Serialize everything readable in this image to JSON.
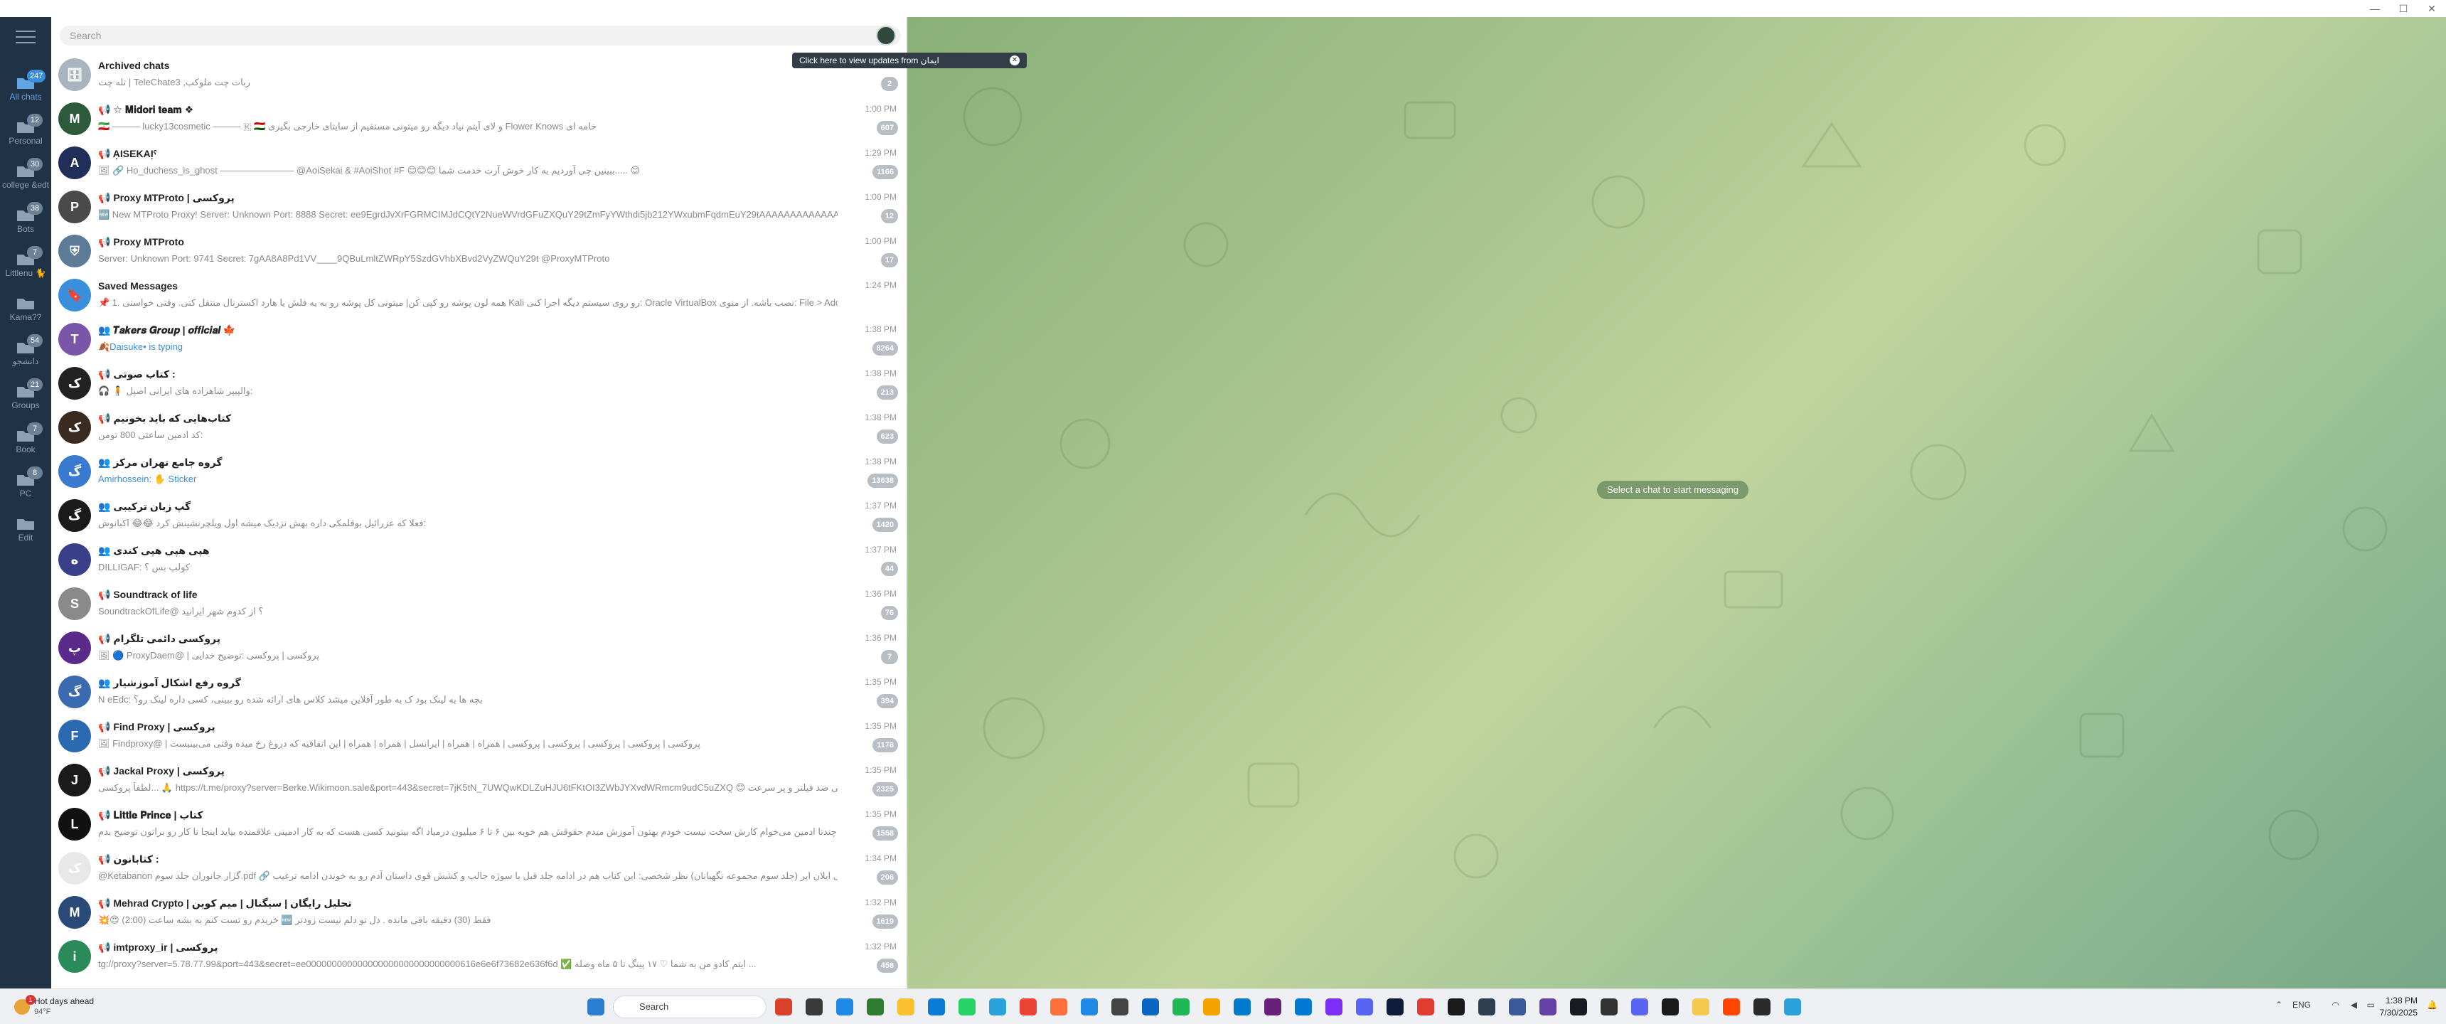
{
  "window": {
    "minimize": "—",
    "maximize": "☐",
    "close": "✕"
  },
  "folders": [
    {
      "label": "All chats",
      "badge": "247",
      "icon": "chat-bubbles-icon",
      "active": true
    },
    {
      "label": "Personal",
      "badge": "12",
      "icon": "folder-icon"
    },
    {
      "label": "college &edt",
      "badge": "30",
      "icon": "folder-icon"
    },
    {
      "label": "Bots",
      "badge": "38",
      "icon": "folder-icon"
    },
    {
      "label": "Littlenu 🐈",
      "badge": "7",
      "icon": "folder-icon"
    },
    {
      "label": "Kama??",
      "badge": "",
      "icon": "folder-icon"
    },
    {
      "label": "دانشجو",
      "badge": "54",
      "icon": "folder-icon"
    },
    {
      "label": "Groups",
      "badge": "21",
      "icon": "folder-icon"
    },
    {
      "label": "Book",
      "badge": "7",
      "icon": "folder-icon"
    },
    {
      "label": "PC",
      "badge": "8",
      "icon": "folder-icon"
    },
    {
      "label": "Edit",
      "badge": "",
      "icon": "edit-icon"
    }
  ],
  "search": {
    "placeholder": "Search"
  },
  "tooltip": {
    "text": "Click here to view updates from ایمان",
    "close": "✕"
  },
  "chats": [
    {
      "name": "Archived chats",
      "preview": "تله چت | TeleChate3 ,ربات چت ملوکب",
      "time": "",
      "badge": "2",
      "avatar_color": "#a9b4be",
      "avatar_text": "🗄"
    },
    {
      "name": "📢 ☆ 𝐌𝐢𝐝𝐨𝐫𝐢 𝐭𝐞𝐚𝐦 ❖",
      "preview": "🇮🇷 ——— lucky13cosmetic ——— 🇰 🇹🇯 و لای آیتم نیاد دیگه رو میتونی مستقیم از سایتای خارجی بگیری Flower Knows خامه ای",
      "time": "1:00 PM",
      "badge": "607",
      "avatar_color": "#2d5a3a",
      "avatar_text": "M"
    },
    {
      "name": "📢 A᷊ISEKAI᷊ˁ",
      "preview": "🖼 🔗 Ho_duchess_is_ghost ———————— @AoiSekai & #AoiShot #F 😊😊😊 ببینین چی آوردیم به کار خوش آرت خدمت شما..... 😊",
      "time": "1:29 PM",
      "badge": "1166",
      "avatar_color": "#1f2f5a",
      "avatar_text": "A"
    },
    {
      "name": "📢 Proxy MTProto | پروکسی",
      "preview": "🆕 New MTProto Proxy! Server: Unknown Port: 8888 Secret: ee9EgrdJvXrFGRMCIMJdCQtY2NueWVrdGFuZXQuY29tZmFyYWthdi5jb212YWxubmFqdmEuY29tAAAAAAAAAAAAAAAAAAAAAAAAAA...",
      "time": "1:00 PM",
      "badge": "12",
      "avatar_color": "#4a4a4a",
      "avatar_text": "P"
    },
    {
      "name": "📢 Proxy MTProto",
      "preview": "Server: Unknown Port: 9741 Secret: 7gAA8A8Pd1VV____9QBuLmltZWRpY5SzdGVhbXBvd2VyZWQuY29t @ProxyMTProto",
      "time": "1:00 PM",
      "badge": "17",
      "avatar_color": "#5d7a96",
      "avatar_text": "⛨"
    },
    {
      "name": "Saved Messages",
      "preview": "📌 1. همه لون پوشه رو کپی کن| میتونی کل پوشه رو به یه فلش یا هارد اکسترنال منتقل کنی. وقتی خواستی Kali رو روی سیستم دیگه اجرا کنی: Oracle VirtualBox نصب باشه. از منوی: File > Add ← Machine > Add ...sq| Copy Edit",
      "time": "1:24 PM",
      "badge": "",
      "avatar_color": "#3a8fdc",
      "avatar_text": "🔖"
    },
    {
      "name": "👥 𝑻𝒂𝒌𝒆𝒓𝒔 𝑮𝒓𝒐𝒖𝒑 | 𝒐𝒇𝒇𝒊𝒄𝒊𝒂𝒍 🍁",
      "preview": "🍂Daisuke• is typing",
      "time": "1:38 PM",
      "badge": "8264",
      "avatar_color": "#7a56a8",
      "avatar_text": "T",
      "preview_hl": true
    },
    {
      "name": "📢 کتاب صوتی :",
      "preview": "🎧 🧍 والپیپر شاهزاده های ایرانی اصیل:",
      "time": "1:38 PM",
      "badge": "213",
      "avatar_color": "#222222",
      "avatar_text": "ک"
    },
    {
      "name": "📢 کتاب‌هایی که باید بخونیم",
      "preview": "کد ادمین ساعتی 800 تومن:",
      "time": "1:38 PM",
      "badge": "623",
      "avatar_color": "#3b2a20",
      "avatar_text": "ک"
    },
    {
      "name": "👥 گروه جامع تهران مرکز",
      "preview": "Amirhossein: ✋ Sticker",
      "time": "1:38 PM",
      "badge": "13638",
      "avatar_color": "#3a7ad0",
      "avatar_text": "گ",
      "preview_hl": true
    },
    {
      "name": "👥 گپ زبان ترکیبی",
      "preview": "فعلا که عزرائیل بوقلمکی داره بهش نزدیک میشه اول ویلچرنشینش کرد 😂😂 اکبانوش:",
      "time": "1:37 PM",
      "badge": "1420",
      "avatar_color": "#1a1a1a",
      "avatar_text": "گ"
    },
    {
      "name": "👥 هپی هپی هپی کندی",
      "preview": "DILLIGAF: کولپ بس ؟",
      "time": "1:37 PM",
      "badge": "44",
      "avatar_color": "#3a3f8a",
      "avatar_text": "ه"
    },
    {
      "name": "📢 Soundtrack of life",
      "preview": "SoundtrackOfLife@ ؟ از کدوم شهر ایرانید",
      "time": "1:36 PM",
      "badge": "76",
      "avatar_color": "#8a8a8a",
      "avatar_text": "S"
    },
    {
      "name": "📢 پروکسی دائمی تلگرام",
      "preview": "🖼 🔵 ProxyDaem@ | پروکسی | پروکسی :توضیح خدایی",
      "time": "1:36 PM",
      "badge": "7",
      "avatar_color": "#5a2a8a",
      "avatar_text": "پ"
    },
    {
      "name": "👥 گروه رفع اشکال آموزشیار",
      "preview": "N eEdc: بچه ها یه لینک بود ک به طور آفلاین میشد کلاس های ارائه شده رو ببینی، کسی داره لینک رو؟",
      "time": "1:35 PM",
      "badge": "394",
      "avatar_color": "#3a6ab0",
      "avatar_text": "گ"
    },
    {
      "name": "📢 Find Proxy | پروکسی",
      "preview": "🖼 Findproxy@ | پروکسی | پروکسی | پروکسی | پروکسی | پروکسی | همراه | همراه | ایرانسل | همراه | همراه | این اتفاقیه که دروغ رخ میده وقتی می‌بینیست",
      "time": "1:35 PM",
      "badge": "1178",
      "avatar_color": "#2a6ab0",
      "avatar_text": "F"
    },
    {
      "name": "📢 Jackal Proxy | پروکسی",
      "preview": "لطفاً پروکسی... 🙏 https://t.me/proxy?server=Berke.Wikimoon.sale&port=443&secret=7jK5tN_7UWQwKDLZuHJU6tFKtOI3ZWbJYXvdWRmcm9udC5uZXQ 😊 پروکسی ضد فیلتر و پر سرعت",
      "time": "1:35 PM",
      "badge": "2325",
      "avatar_color": "#1a1a1a",
      "avatar_text": "J"
    },
    {
      "name": "📢 𝐋𝐢𝐭𝐭𝐥𝐞 𝐏𝐫𝐢𝐧𝐜𝐞 | کتاب",
      "preview": "بچه‌ها چندتا ادمین می‌خوام کارش سخت نیست خودم بهتون آموزش میدم حقوقش هم خوبه بین ۶ تا ۶ میلیون درمیاد اگه بیتونید کسی هست که به کار ادمینی علاقمنده بیاید اینجا تا کار رو براتون توضیح بدم ...",
      "time": "1:35 PM",
      "badge": "1558",
      "avatar_color": "#111111",
      "avatar_text": "L"
    },
    {
      "name": "📢 کتابانون :",
      "preview": "@Ketabanon گزار جانوران جلد سوم.pdf 🔗 گلزار جانوران به نویسندگی ایلان ایر (جلد سوم مجموعه نگهبانان) نظر شخصی: این کتاب هم در ادامه جلد قبل با سوژه جالب و کشش قوی داستان آدم رو به خوندن ادامه ترغیب...",
      "time": "1:34 PM",
      "badge": "206",
      "avatar_color": "#e8e8e8",
      "avatar_text": "ک"
    },
    {
      "name": "📢 Mehrad Crypto | تحلیل رایگان | سیگنال | میم کوین",
      "preview": "💥😍 خریدم رو تست کنم به بشه ساعت (2:00) 🆕 فقط (30) دقیقه باقی مانده . دل تو دلم نیست زودتر",
      "time": "1:32 PM",
      "badge": "1619",
      "avatar_color": "#2a4a7a",
      "avatar_text": "M"
    },
    {
      "name": "📢 imtproxy_ir | پروکسی",
      "preview": "tg://proxy?server=5.78.77.99&port=443&secret=ee000000000000000000000000000000616e6e6f73682e636f6d ✅ ایتم کادو من به شما ♡ ۱۷ پینگ تا ۵ ماه وصله ...",
      "time": "1:32 PM",
      "badge": "458",
      "avatar_color": "#2a8a5a",
      "avatar_text": "i"
    }
  ],
  "main": {
    "empty_label": "Select a chat to start messaging"
  },
  "taskbar": {
    "weather_title": "Hot days ahead",
    "weather_temp": "94°F",
    "weather_alert": "1",
    "search_placeholder": "Search",
    "time": "1:38 PM",
    "date": "7/30/2025",
    "lang": "ENG"
  }
}
